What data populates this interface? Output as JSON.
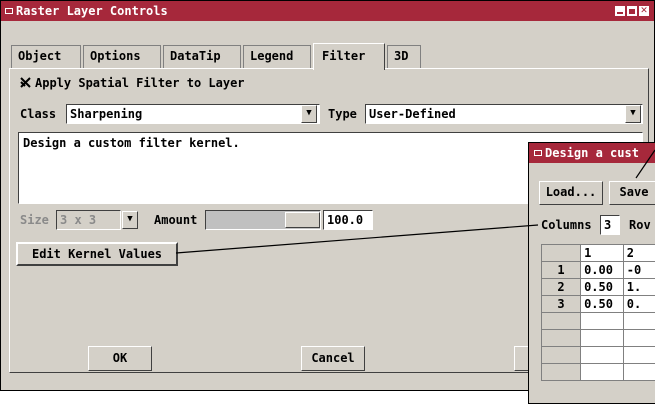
{
  "window": {
    "title": "Raster Layer Controls"
  },
  "tabs": [
    {
      "label": "Object"
    },
    {
      "label": "Options"
    },
    {
      "label": "DataTip"
    },
    {
      "label": "Legend"
    },
    {
      "label": "Filter",
      "active": true
    },
    {
      "label": "3D"
    }
  ],
  "filter": {
    "apply_label": "Apply Spatial Filter to Layer",
    "apply_checked": true,
    "class_label": "Class",
    "class_value": "Sharpening",
    "type_label": "Type",
    "type_value": "User-Defined",
    "description": "Design a custom filter kernel.",
    "size_label": "Size",
    "size_value": "3 x 3",
    "amount_label": "Amount",
    "amount_value": "100.0",
    "edit_kernel_label": "Edit Kernel Values"
  },
  "buttons": {
    "ok": "OK",
    "cancel": "Cancel"
  },
  "kernel_dialog": {
    "title": "Design a cust",
    "load_label": "Load...",
    "save_label": "Save",
    "columns_label": "Columns",
    "columns_value": "3",
    "rows_label": "Rov",
    "col_headers": [
      "1",
      "2"
    ],
    "rows": [
      {
        "index": "1",
        "c1": "0.00",
        "c2": "-0"
      },
      {
        "index": "2",
        "c1": "0.50",
        "c2": "1."
      },
      {
        "index": "3",
        "c1": "0.50",
        "c2": "0."
      }
    ]
  },
  "colors": {
    "titlebar": "#a6283b",
    "face": "#d4d0c8"
  }
}
